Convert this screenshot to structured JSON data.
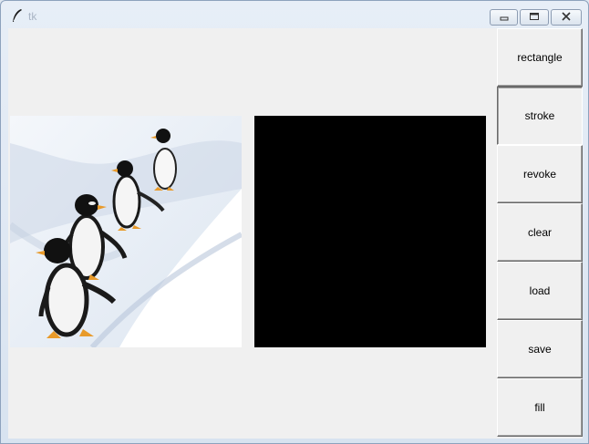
{
  "window": {
    "title": "tk",
    "controls": [
      "minimize-icon",
      "maximize-icon",
      "close-icon"
    ]
  },
  "main": {
    "image_panel": {
      "description_icon": "penguins-photo"
    },
    "canvas_panel": {
      "background": "#000000"
    }
  },
  "sidebar": {
    "buttons": [
      {
        "label": "rectangle",
        "pressed": false
      },
      {
        "label": "stroke",
        "pressed": true
      },
      {
        "label": "revoke",
        "pressed": false
      },
      {
        "label": "clear",
        "pressed": false
      },
      {
        "label": "load",
        "pressed": false
      },
      {
        "label": "save",
        "pressed": false
      },
      {
        "label": "fill",
        "pressed": false
      }
    ]
  },
  "colors": {
    "client_bg": "#f0f0f0",
    "titlebar": "#dfe7f1",
    "title_text": "#a8b4c4"
  }
}
